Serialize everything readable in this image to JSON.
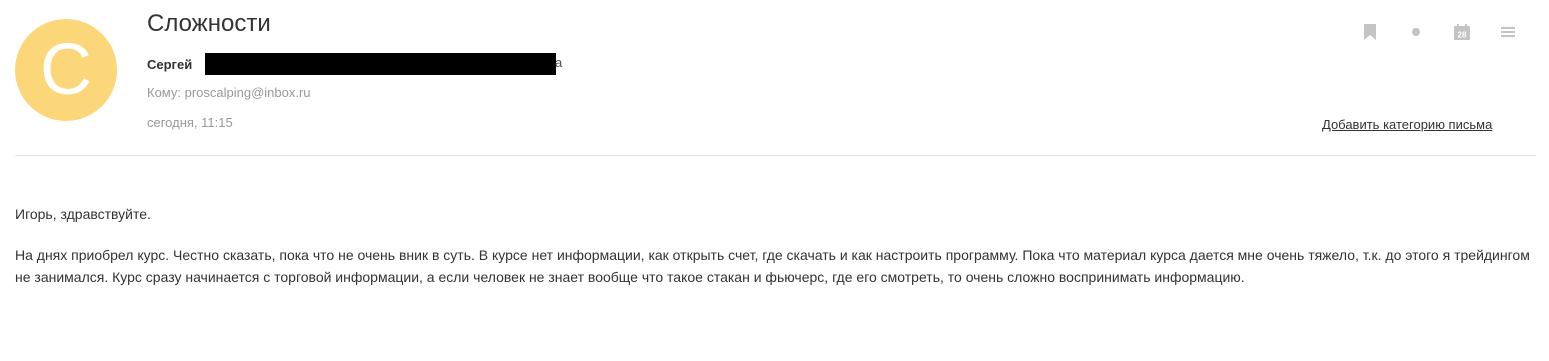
{
  "avatar": {
    "letter": "С",
    "color": "#fbd77a"
  },
  "email": {
    "subject": "Сложности",
    "sender_name": "Сергей",
    "sender_tail": "a",
    "to_label": "Кому: proscalping@inbox.ru",
    "date": "сегодня, 11:15",
    "add_category_label": "Добавить категорию письма"
  },
  "toolbar": {
    "icons": [
      "bookmark-icon",
      "dot-icon",
      "calendar-icon",
      "menu-icon"
    ],
    "calendar_day": "28"
  },
  "body": {
    "greeting": "Игорь, здравствуйте.",
    "paragraph": "На днях приобрел курс. Честно сказать, пока что не очень вник в суть. В курсе нет информации, как открыть счет, где скачать и как настроить программу. Пока что материал курса дается мне очень тяжело, т.к. до этого я трейдингом не занимался. Курс сразу начинается с торговой информации, а если человек не знает вообще что такое стакан и фьючерс, где его смотреть, то очень сложно воспринимать информацию."
  }
}
